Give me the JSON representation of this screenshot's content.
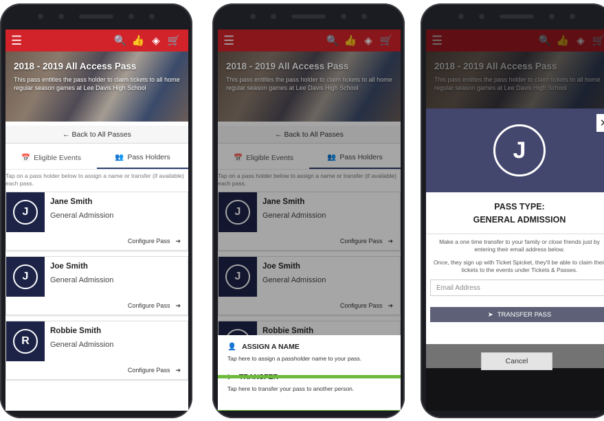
{
  "icons": {
    "menu": "☰",
    "search": "🔍",
    "thumb": "👍",
    "tag": "◈",
    "cart": "🛒",
    "back_arrow": "←",
    "calendar": "📅",
    "users": "👥",
    "arrow_right": "➔",
    "person": "👤",
    "send": "➤",
    "close": "✕"
  },
  "colors": {
    "topbar": "#d2232a",
    "avatar_bg": "#1c2347",
    "highlight": "#6cbb3c"
  },
  "pass": {
    "title": "2018 - 2019 All Access Pass",
    "description": "This pass entitles the pass holder to claim tickets to all home regular season games at Lee Davis High School"
  },
  "nav": {
    "back": "Back to All Passes"
  },
  "tabs": {
    "eligible": "Eligible Events",
    "holders": "Pass Holders"
  },
  "hint": "Tap on a pass holder below to assign a name or transfer (if available) each pass.",
  "configure": "Configure Pass",
  "holders": [
    {
      "initial": "J",
      "name": "Jane Smith",
      "type": "General Admission"
    },
    {
      "initial": "J",
      "name": "Joe Smith",
      "type": "General Admission"
    },
    {
      "initial": "R",
      "name": "Robbie Smith",
      "type": "General Admission"
    }
  ],
  "sheet": {
    "assign_title": "ASSIGN A NAME",
    "assign_desc": "Tap here to assign a passholder name to your pass.",
    "transfer_title": "TRANSFER",
    "transfer_desc": "Tap here to transfer your pass to another person."
  },
  "modal": {
    "initial": "J",
    "pass_type_label": "PASS TYPE:",
    "pass_type": "GENERAL ADMISSION",
    "text1": "Make a one time transfer to your family or close friends just by entering their email address below.",
    "text2": "Once, they sign up with Ticket Spicket, they'll be able to claim their tickets to the events under Tickets & Passes.",
    "email_placeholder": "Email Address",
    "transfer_button": "TRANSFER PASS",
    "cancel": "Cancel"
  }
}
